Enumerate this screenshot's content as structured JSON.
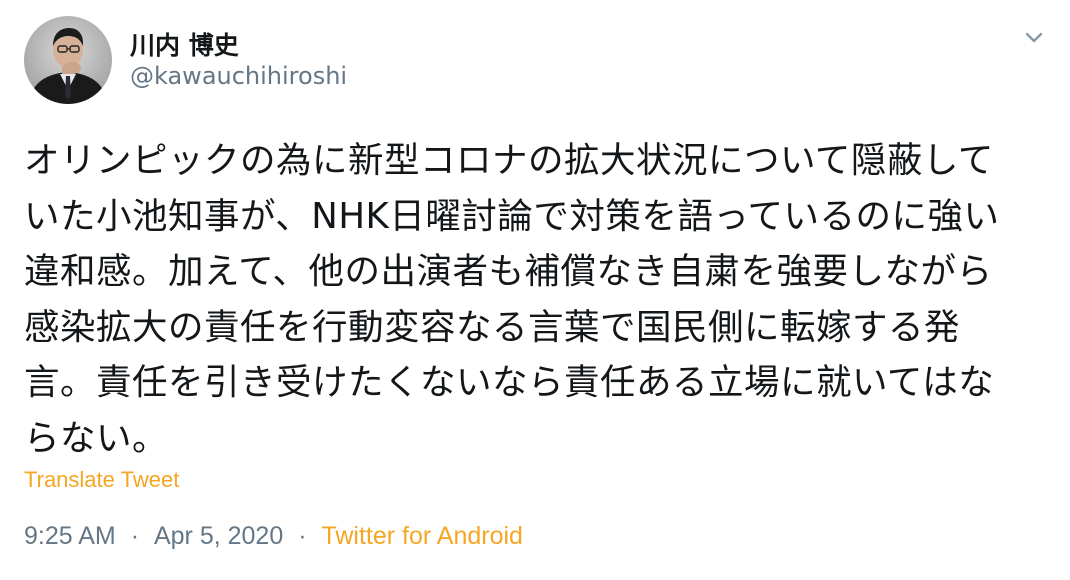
{
  "tweet": {
    "author": {
      "display_name": "川内 博史",
      "handle": "@kawauchihiroshi",
      "avatar_icon": "avatar-photo"
    },
    "menu_icon": "chevron-down-icon",
    "text": "オリンピックの為に新型コロナの拡大状況について隠蔽していた小池知事が、NHK日曜討論で対策を語っているのに強い違和感。加えて、他の出演者も補償なき自粛を強要しながら感染拡大の責任を行動変容なる言葉で国民側に転嫁する発言。責任を引き受けたくないなら責任ある立場に就いてはならない。",
    "translate_label": "Translate Tweet",
    "time": "9:25 AM",
    "date_separator": "·",
    "date": "Apr 5, 2020",
    "source_separator": "·",
    "source": "Twitter for Android",
    "colors": {
      "text": "#14171a",
      "secondary": "#657786",
      "accent": "#f5a623",
      "background": "#ffffff"
    }
  }
}
